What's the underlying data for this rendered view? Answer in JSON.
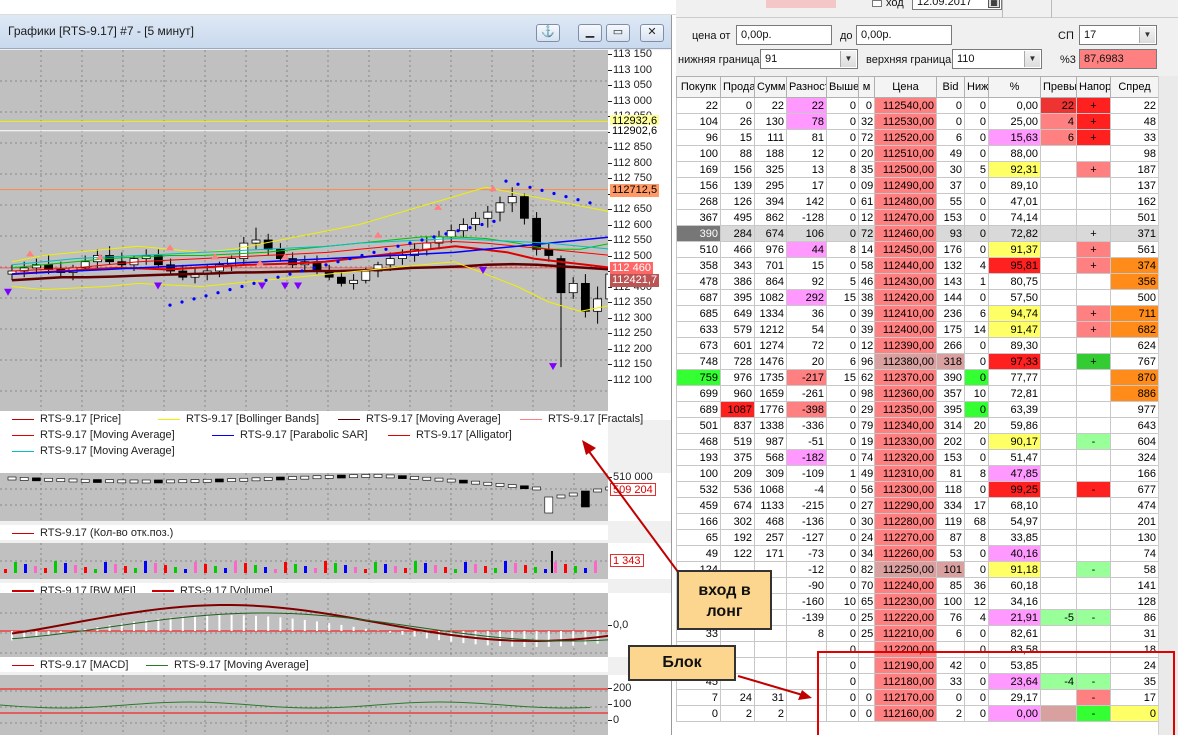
{
  "window": {
    "title": "Графики [RTS-9.17] #7 - [5 минут]"
  },
  "colors": {
    "pane_bg": "#c0c0c0",
    "price": "#000000",
    "bollinger": "#f0f000",
    "ma_dark": "#600000",
    "fractals_up": "#ff8080",
    "fractals_down": "#8000ff",
    "ma_red": "#e00000",
    "psar": "#0000ff",
    "alligator_jaw": "#0000ff",
    "alligator_teeth": "#ff0000",
    "alligator_lips": "#00c000",
    "pink": "#ff99ff",
    "yellow": "#ffff66",
    "red": "#ff2020",
    "lightred": "#ff8080",
    "orange": "#ff8c1a",
    "green": "#33ff33",
    "lightgreen": "#99ff99",
    "gray": "#d9d9d9",
    "rosegray": "#d9a0a0"
  },
  "price_pane": {
    "y_ticks": [
      "113 150",
      "113 100",
      "113 050",
      "113 000",
      "112 950",
      "112 900",
      "112 850",
      "112 800",
      "112 750",
      "112 700",
      "112 650",
      "112 600",
      "112 550",
      "112 500",
      "112 450",
      "112 400",
      "112 350",
      "112 300",
      "112 250",
      "112 200",
      "112 150",
      "112 100"
    ],
    "highlights": [
      {
        "label": "112932,6",
        "color": "#ffff99"
      },
      {
        "label": "112902,6",
        "color": "#ffffff"
      },
      {
        "label": "112712,5",
        "color": "#ff9966"
      },
      {
        "label": "112 460",
        "color": "#ff6666"
      },
      {
        "label": "112421,7",
        "color": "#bb5555"
      }
    ],
    "legend": [
      {
        "text": "RTS-9.17 [Price]",
        "color": "#c00000"
      },
      {
        "text": "RTS-9.17 [Bollinger Bands]",
        "color": "#f0f000"
      },
      {
        "text": "RTS-9.17 [Moving Average]",
        "color": "#600000"
      },
      {
        "text": "RTS-9.17 [Fractals]",
        "color": "#ff8080"
      },
      {
        "text": "RTS-9.17 [Moving Average]",
        "color": "#e00000"
      },
      {
        "text": "RTS-9.17 [Parabolic SAR]",
        "color": "#0000ff"
      },
      {
        "text": "RTS-9.17 [Alligator]",
        "color": "#e00000"
      },
      {
        "text": "RTS-9.17 [Moving Average]",
        "color": "#00c0c0"
      }
    ]
  },
  "oi_pane": {
    "ticks": [
      "510 000"
    ],
    "value": "509 204",
    "legend": "RTS-9.17 (Кол-во отк.поз.)"
  },
  "mfi_pane": {
    "value": "1 343",
    "legend": [
      "RTS-9.17 [BW MFI]",
      "RTS-9.17 [Volume]"
    ]
  },
  "macd_pane": {
    "ticks": [
      "0,0"
    ],
    "legend": [
      "RTS-9.17 [MACD]",
      "RTS-9.17 [Moving Average]"
    ]
  },
  "stoch_pane": {
    "ticks": [
      "200",
      "100",
      "0"
    ]
  },
  "filters": {
    "date_label": "ход",
    "date_value": "12.09.2017",
    "price_from_label": "цена от",
    "price_from": "0,00р.",
    "price_to_label": "до",
    "price_to": "0,00р.",
    "sp_label": "СП",
    "sp_value": "17",
    "lower_label": "нижняя граница",
    "lower_value": "91",
    "upper_label": "верхняя граница",
    "upper_value": "110",
    "pct3_label": "%3",
    "pct3_value": "87,6983"
  },
  "table": {
    "columns": [
      "Покупк",
      "Продаж",
      "Сумма",
      "Разност",
      "Выше",
      "м",
      "Цена",
      "Bid",
      "Ниж",
      "%",
      "Превыш",
      "Напор",
      "Спред"
    ],
    "rows": [
      [
        "22",
        "0",
        "22",
        "22",
        "0",
        "0",
        "112540,00",
        "0",
        "0",
        "0,00",
        "22",
        "+",
        "22"
      ],
      [
        "104",
        "26",
        "130",
        "78",
        "0",
        "32",
        "112530,00",
        "0",
        "0",
        "25,00",
        "4",
        "+",
        "48"
      ],
      [
        "96",
        "15",
        "111",
        "81",
        "0",
        "72",
        "112520,00",
        "6",
        "0",
        "15,63",
        "6",
        "+",
        "33"
      ],
      [
        "100",
        "88",
        "188",
        "12",
        "0",
        "20",
        "112510,00",
        "49",
        "0",
        "88,00",
        "",
        "",
        "98"
      ],
      [
        "169",
        "156",
        "325",
        "13",
        "8",
        "35",
        "112500,00",
        "30",
        "5",
        "92,31",
        "",
        "+",
        "187"
      ],
      [
        "156",
        "139",
        "295",
        "17",
        "0",
        "09",
        "112490,00",
        "37",
        "0",
        "89,10",
        "",
        "",
        "137"
      ],
      [
        "268",
        "126",
        "394",
        "142",
        "0",
        "61",
        "112480,00",
        "55",
        "0",
        "47,01",
        "",
        "",
        "162"
      ],
      [
        "367",
        "495",
        "862",
        "-128",
        "0",
        "12",
        "112470,00",
        "153",
        "0",
        "74,14",
        "",
        "",
        "501"
      ],
      [
        "390",
        "284",
        "674",
        "106",
        "0",
        "72",
        "112460,00",
        "93",
        "0",
        "72,82",
        "",
        "+",
        "371"
      ],
      [
        "510",
        "466",
        "976",
        "44",
        "8",
        "14",
        "112450,00",
        "176",
        "0",
        "91,37",
        "",
        "+",
        "561"
      ],
      [
        "358",
        "343",
        "701",
        "15",
        "0",
        "58",
        "112440,00",
        "132",
        "4",
        "95,81",
        "",
        "+",
        "374"
      ],
      [
        "478",
        "386",
        "864",
        "92",
        "5",
        "46",
        "112430,00",
        "143",
        "1",
        "80,75",
        "",
        "",
        "356"
      ],
      [
        "687",
        "395",
        "1082",
        "292",
        "15",
        "38",
        "112420,00",
        "144",
        "0",
        "57,50",
        "",
        "",
        "500"
      ],
      [
        "685",
        "649",
        "1334",
        "36",
        "0",
        "39",
        "112410,00",
        "236",
        "6",
        "94,74",
        "",
        "+",
        "711"
      ],
      [
        "633",
        "579",
        "1212",
        "54",
        "0",
        "39",
        "112400,00",
        "175",
        "14",
        "91,47",
        "",
        "+",
        "682"
      ],
      [
        "673",
        "601",
        "1274",
        "72",
        "0",
        "12",
        "112390,00",
        "266",
        "0",
        "89,30",
        "",
        "",
        "624"
      ],
      [
        "748",
        "728",
        "1476",
        "20",
        "6",
        "96",
        "112380,00",
        "318",
        "0",
        "97,33",
        "",
        "+",
        "767"
      ],
      [
        "759",
        "976",
        "1735",
        "-217",
        "15",
        "62",
        "112370,00",
        "390",
        "0",
        "77,77",
        "",
        "",
        "870"
      ],
      [
        "699",
        "960",
        "1659",
        "-261",
        "0",
        "98",
        "112360,00",
        "357",
        "10",
        "72,81",
        "",
        "",
        "886"
      ],
      [
        "689",
        "1087",
        "1776",
        "-398",
        "0",
        "29",
        "112350,00",
        "395",
        "0",
        "63,39",
        "",
        "",
        "977"
      ],
      [
        "501",
        "837",
        "1338",
        "-336",
        "0",
        "79",
        "112340,00",
        "314",
        "20",
        "59,86",
        "",
        "",
        "643"
      ],
      [
        "468",
        "519",
        "987",
        "-51",
        "0",
        "19",
        "112330,00",
        "202",
        "0",
        "90,17",
        "",
        "-",
        "604"
      ],
      [
        "193",
        "375",
        "568",
        "-182",
        "0",
        "74",
        "112320,00",
        "153",
        "0",
        "51,47",
        "",
        "",
        "324"
      ],
      [
        "100",
        "209",
        "309",
        "-109",
        "1",
        "49",
        "112310,00",
        "81",
        "8",
        "47,85",
        "",
        "",
        "166"
      ],
      [
        "532",
        "536",
        "1068",
        "-4",
        "0",
        "56",
        "112300,00",
        "118",
        "0",
        "99,25",
        "",
        "-",
        "677"
      ],
      [
        "459",
        "674",
        "1133",
        "-215",
        "0",
        "27",
        "112290,00",
        "334",
        "17",
        "68,10",
        "",
        "",
        "474"
      ],
      [
        "166",
        "302",
        "468",
        "-136",
        "0",
        "30",
        "112280,00",
        "119",
        "68",
        "54,97",
        "",
        "",
        "201"
      ],
      [
        "65",
        "192",
        "257",
        "-127",
        "0",
        "24",
        "112270,00",
        "87",
        "8",
        "33,85",
        "",
        "",
        "130"
      ],
      [
        "49",
        "122",
        "171",
        "-73",
        "0",
        "34",
        "112260,00",
        "53",
        "0",
        "40,16",
        "",
        "",
        "74"
      ],
      [
        "",
        "",
        "",
        "-12",
        "0",
        "82",
        "112250,00",
        "101",
        "0",
        "91,18",
        "",
        "-",
        "58"
      ],
      [
        "",
        "",
        "",
        "-90",
        "0",
        "70",
        "112240,00",
        "85",
        "36",
        "60,18",
        "",
        "",
        "141"
      ],
      [
        "",
        "",
        "",
        "-160",
        "10",
        "65",
        "112230,00",
        "100",
        "12",
        "34,16",
        "",
        "",
        "128"
      ],
      [
        "",
        "",
        "",
        "-139",
        "0",
        "25",
        "112220,00",
        "76",
        "4",
        "21,91",
        "-5",
        "-",
        "86"
      ],
      [
        "",
        "",
        "",
        "8",
        "0",
        "25",
        "112210,00",
        "6",
        "0",
        "82,61",
        "",
        "",
        "31"
      ],
      [
        "",
        "",
        "",
        "",
        "0",
        "",
        "112200,00",
        "",
        "0",
        "83,58",
        "",
        "",
        "18"
      ],
      [
        "",
        "",
        "",
        "",
        "0",
        "",
        "112190,00",
        "42",
        "0",
        "53,85",
        "",
        "",
        "24"
      ],
      [
        "",
        "",
        "",
        "",
        "0",
        "",
        "112180,00",
        "33",
        "0",
        "23,64",
        "-4",
        "-",
        "35"
      ],
      [
        "7",
        "24",
        "31",
        "",
        "0",
        "0",
        "112170,00",
        "0",
        "0",
        "29,17",
        "",
        "-",
        "17"
      ],
      [
        "0",
        "2",
        "2",
        "",
        "0",
        "0",
        "112160,00",
        "2",
        "0",
        "0,00",
        "",
        "-",
        "0"
      ]
    ],
    "partial_left": [
      "",
      "",
      "",
      "",
      "",
      "",
      "",
      "",
      "",
      "",
      "",
      "",
      "",
      "",
      "",
      "",
      "",
      "",
      "",
      "",
      "",
      "",
      "",
      "",
      "",
      "",
      "",
      "",
      "",
      "124",
      "",
      "",
      "",
      "33",
      "67",
      "65",
      "45",
      "",
      ""
    ]
  },
  "annotations": {
    "long_entry": "вход в лонг",
    "block": "Блок"
  }
}
